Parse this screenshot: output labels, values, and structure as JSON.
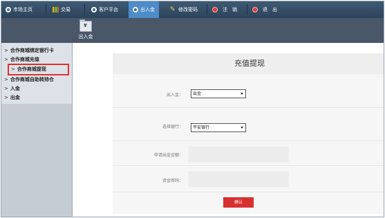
{
  "topnav": {
    "items": [
      {
        "label": "市场主页",
        "icon": "globe-icon"
      },
      {
        "label": "交易",
        "icon": "chart-icon"
      },
      {
        "label": "客户平台",
        "icon": "globe-icon"
      },
      {
        "label": "出入金",
        "icon": "globe-icon",
        "active": true
      },
      {
        "label": "修改密码",
        "icon": "key-icon"
      },
      {
        "label": "注　销",
        "icon": "power-icon"
      },
      {
        "label": "退　出",
        "icon": "power-icon"
      }
    ],
    "active_color": "#4d8cc8"
  },
  "toolbar": {
    "deposit_withdraw_label": "出入金"
  },
  "sidebar": {
    "items": [
      {
        "label": "合作商城绑定银行卡"
      },
      {
        "label": "合作商城充值"
      },
      {
        "label": "合作商城提现",
        "highlighted": true
      },
      {
        "label": "合作商城自助转持仓"
      },
      {
        "label": "入金"
      },
      {
        "label": "出金"
      }
    ],
    "highlight_color": "#e03030"
  },
  "form": {
    "title": "充值提现",
    "inout_label": "出入金：",
    "inout_value": "出金",
    "bank_label": "选择银行：",
    "bank_value": "平安银行",
    "amount_label": "申请出金金额：",
    "amount_value": "",
    "password_label": "资金密码：",
    "password_value": "",
    "confirm_label": "确认",
    "confirm_color": "#d83030"
  }
}
